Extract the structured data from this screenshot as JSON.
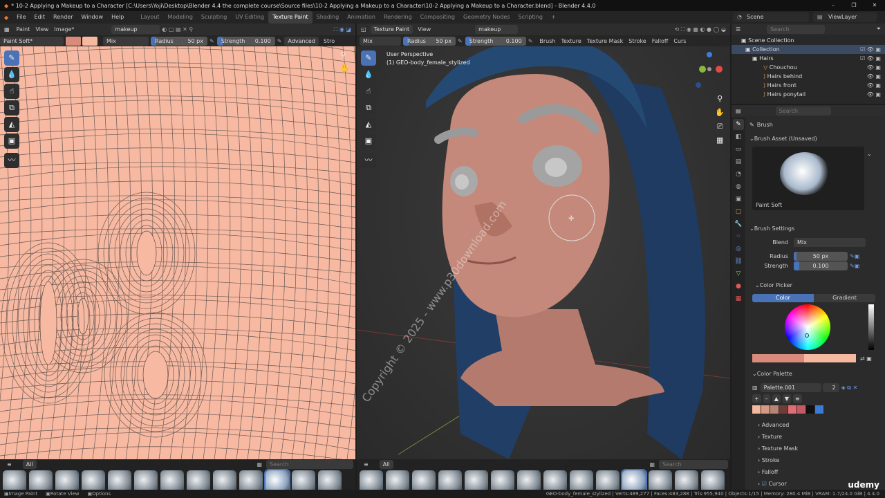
{
  "window": {
    "title": "* 10-2 Applying a Makeup to a Character [C:\\Users\\Yoji\\Desktop\\Blender 4.4 the complete course\\Source files\\10-2 Applying a Makeup to a Character\\10-2 Applying a Makeup to a Character.blend] - Blender 4.4.0",
    "controls": [
      "–",
      "❐",
      "✕"
    ]
  },
  "topbar": {
    "menus": [
      "File",
      "Edit",
      "Render",
      "Window",
      "Help"
    ],
    "workspaces": [
      "Layout",
      "Modeling",
      "Sculpting",
      "UV Editing",
      "Texture Paint",
      "Shading",
      "Animation",
      "Rendering",
      "Compositing",
      "Geometry Nodes",
      "Scripting"
    ],
    "active_workspace": "Texture Paint",
    "add_tab": "+",
    "scene": "Scene",
    "view_layer": "ViewLayer"
  },
  "image_editor": {
    "mode": "Paint",
    "view": "View",
    "image_menu": "Image*",
    "image_name": "makeup",
    "brush_name": "Paint Soft*",
    "blend": "Mix",
    "radius_label": "Radius",
    "radius_value": "50 px",
    "strength_label": "Strength",
    "strength_value": "0.100",
    "advanced": "Advanced",
    "stroke": "Stro",
    "brush_filter": "All",
    "search_placeholder": "Search"
  },
  "viewport": {
    "mode": "Texture Paint",
    "view": "View",
    "image_name": "makeup",
    "blend": "Mix",
    "radius_label": "Radius",
    "radius_value": "50 px",
    "strength_label": "Strength",
    "strength_value": "0.100",
    "menus": [
      "Brush",
      "Texture",
      "Texture Mask",
      "Stroke",
      "Falloff",
      "Curs"
    ],
    "overlay_line1": "User Perspective",
    "overlay_line2": "(1) GEO-body_female_stylized",
    "watermark": "Copyright © 2025 - www.p30download.com",
    "brush_filter": "All",
    "search_placeholder": "Search"
  },
  "outliner": {
    "search_placeholder": "Search",
    "items": [
      {
        "label": "Scene Collection"
      },
      {
        "label": "Collection"
      },
      {
        "label": "Hairs"
      },
      {
        "label": "Chouchou"
      },
      {
        "label": "Hairs behind"
      },
      {
        "label": "Hairs front"
      },
      {
        "label": "Hairs ponytail"
      }
    ]
  },
  "properties": {
    "search_placeholder": "Search",
    "context": "Brush",
    "brush_asset_header": "Brush Asset (Unsaved)",
    "brush_asset_name": "Paint Soft",
    "brush_settings_header": "Brush Settings",
    "blend_label": "Blend",
    "blend_value": "Mix",
    "radius_label": "Radius",
    "radius_value": "50 px",
    "strength_label": "Strength",
    "strength_value": "0.100",
    "color_picker_header": "Color Picker",
    "color_tab": "Color",
    "gradient_tab": "Gradient",
    "color_palette_header": "Color Palette",
    "palette_name": "Palette.001",
    "palette_users": "2",
    "palette_ops": [
      "+",
      "–",
      "▲",
      "▼",
      "≡"
    ],
    "palette_colors": [
      "#f4b89d",
      "#d49a86",
      "#b78476",
      "#6f3d35",
      "#e06c75",
      "#c45a63",
      "#111111",
      "#3a7bd5"
    ],
    "subpanels": [
      "Advanced",
      "Texture",
      "Texture Mask",
      "Stroke",
      "Falloff",
      "Cursor"
    ]
  },
  "statusbar": {
    "left": [
      "Image Paint",
      "Rotate View",
      "Options"
    ],
    "right": "GEO-body_female_stylized | Verts:489,277 | Faces:483,288 | Tris:955,940 | Objects:1/15 | Memory: 280.4 MiB | VRAM: 1.7/24.0 GiB | 4.4.0",
    "brand": "udemy"
  },
  "colors": {
    "accent": "#4a72b6",
    "skin": "#f7b9a2",
    "primary_swatch": "#d98a7a",
    "secondary_swatch": "#f6b89f"
  }
}
